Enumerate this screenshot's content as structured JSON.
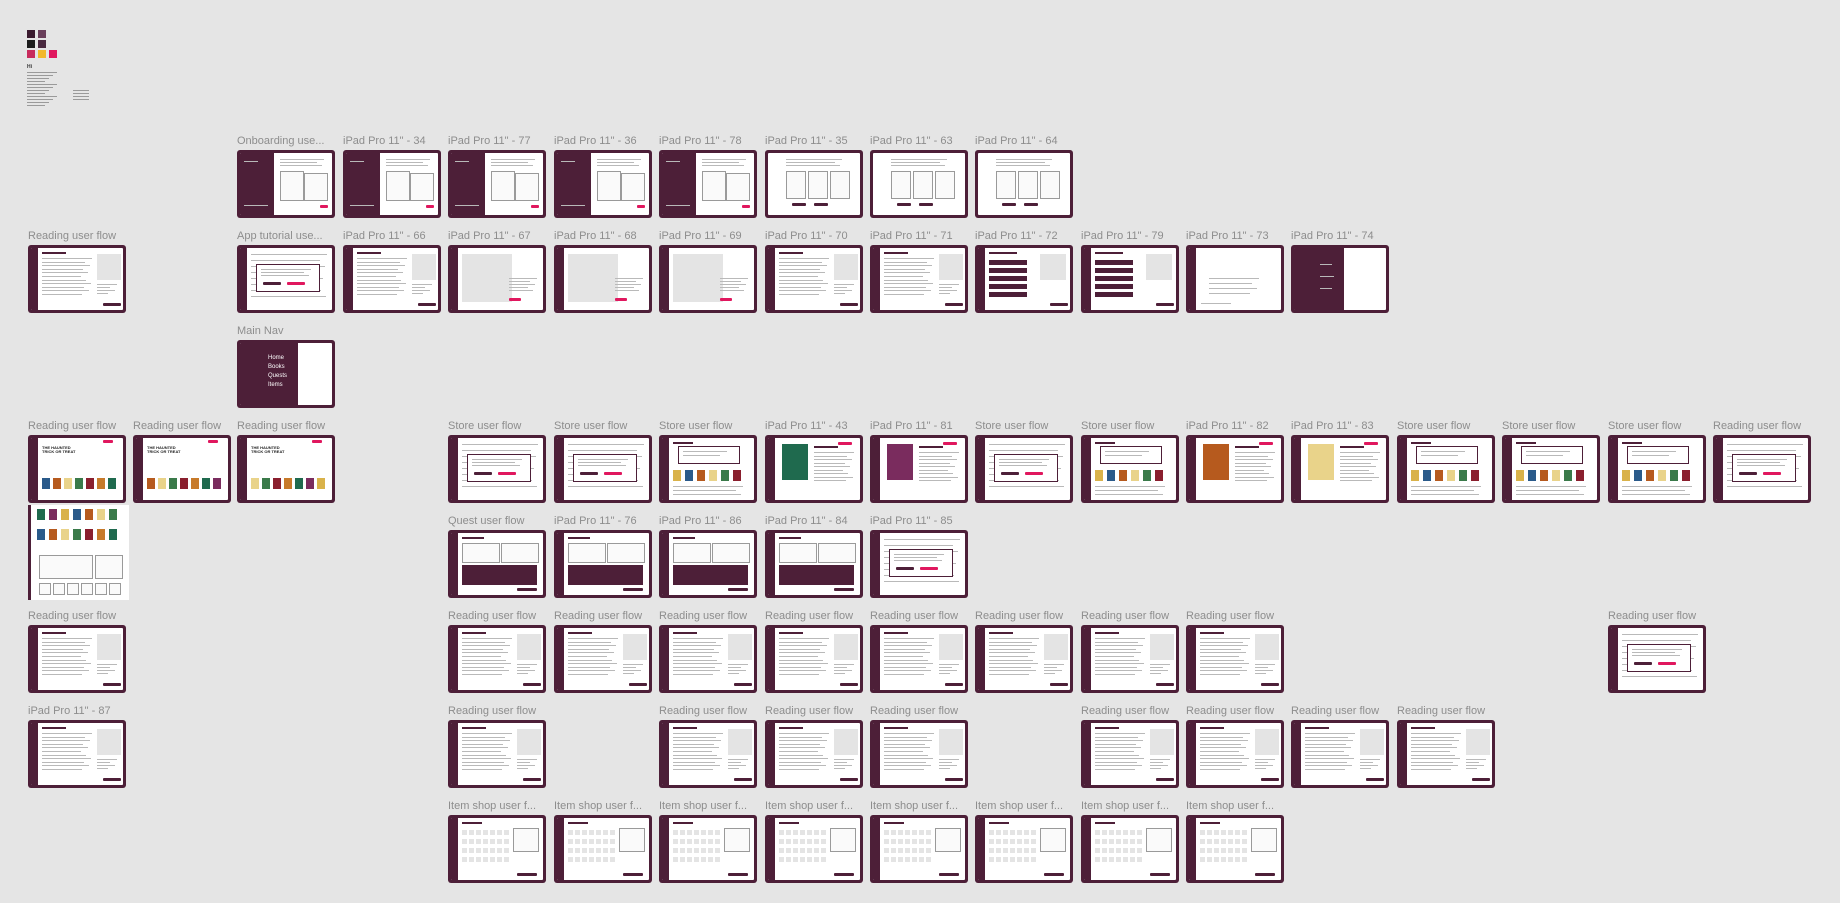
{
  "style_legend": {
    "swatches": [
      "#3a1a2e",
      "#6a3f5b",
      "#1c1c1c",
      "#4a2a40",
      "#c72b5c",
      "#f2b82c",
      "#e0175e"
    ],
    "title": "Hi"
  },
  "frames": [
    {
      "label": "Onboarding use...",
      "type": "onboard"
    },
    {
      "label": "iPad Pro 11\" - 34",
      "type": "onboard"
    },
    {
      "label": "iPad Pro 11\" - 77",
      "type": "onboard"
    },
    {
      "label": "iPad Pro 11\" - 36",
      "type": "onboard"
    },
    {
      "label": "iPad Pro 11\" - 78",
      "type": "onboard"
    },
    {
      "label": "iPad Pro 11\" - 35",
      "type": "sketch"
    },
    {
      "label": "iPad Pro 11\" - 63",
      "type": "sketch"
    },
    {
      "label": "iPad Pro 11\" - 64",
      "type": "sketch"
    },
    {
      "label": "Reading user flow",
      "type": "reading"
    },
    {
      "label": "App tutorial use...",
      "type": "dialog"
    },
    {
      "label": "iPad Pro 11\" - 66",
      "type": "reading"
    },
    {
      "label": "iPad Pro 11\" - 67",
      "type": "tutorial"
    },
    {
      "label": "iPad Pro 11\" - 68",
      "type": "tutorial"
    },
    {
      "label": "iPad Pro 11\" - 69",
      "type": "tutorial"
    },
    {
      "label": "iPad Pro 11\" - 70",
      "type": "reading"
    },
    {
      "label": "iPad Pro 11\" - 71",
      "type": "reading"
    },
    {
      "label": "iPad Pro 11\" - 72",
      "type": "quiz"
    },
    {
      "label": "iPad Pro 11\" - 79",
      "type": "quiz"
    },
    {
      "label": "iPad Pro 11\" - 73",
      "type": "blank"
    },
    {
      "label": "iPad Pro 11\" - 74",
      "type": "menu"
    },
    {
      "label": "Main Nav",
      "type": "mainnav",
      "items": [
        "Home",
        "Books",
        "Quests",
        "Items"
      ]
    },
    {
      "label": "Reading user flow",
      "type": "home",
      "heading": "THE HAUNTED TRICK OR TREAT"
    },
    {
      "label": "Reading user flow",
      "type": "home",
      "heading": "THE HAUNTED TRICK OR TREAT"
    },
    {
      "label": "Reading user flow",
      "type": "home",
      "heading": "THE HAUNTED TRICK OR TREAT"
    },
    {
      "label": "Store user flow",
      "type": "dialog"
    },
    {
      "label": "Store user flow",
      "type": "dialog"
    },
    {
      "label": "Store user flow",
      "type": "store"
    },
    {
      "label": "iPad Pro 11\" - 43",
      "type": "bookdetail"
    },
    {
      "label": "iPad Pro 11\" - 81",
      "type": "bookdetail"
    },
    {
      "label": "Store user flow",
      "type": "dialog"
    },
    {
      "label": "Store user flow",
      "type": "store"
    },
    {
      "label": "iPad Pro 11\" - 82",
      "type": "bookdetail"
    },
    {
      "label": "iPad Pro 11\" - 83",
      "type": "bookdetail"
    },
    {
      "label": "Store user flow",
      "type": "store"
    },
    {
      "label": "Store user flow",
      "type": "store"
    },
    {
      "label": "Store user flow",
      "type": "store"
    },
    {
      "label": "Reading user flow",
      "type": "dialog"
    },
    {
      "label": "Quest user flow",
      "type": "quest"
    },
    {
      "label": "iPad Pro 11\" - 76",
      "type": "quest"
    },
    {
      "label": "iPad Pro 11\" - 86",
      "type": "quest"
    },
    {
      "label": "iPad Pro 11\" - 84",
      "type": "quest"
    },
    {
      "label": "iPad Pro 11\" - 85",
      "type": "dialog"
    },
    {
      "label": "Reading user flow",
      "type": "reading"
    },
    {
      "label": "Reading user flow",
      "type": "reading"
    },
    {
      "label": "Reading user flow",
      "type": "reading"
    },
    {
      "label": "Reading user flow",
      "type": "reading"
    },
    {
      "label": "Reading user flow",
      "type": "reading"
    },
    {
      "label": "Reading user flow",
      "type": "reading"
    },
    {
      "label": "Reading user flow",
      "type": "reading"
    },
    {
      "label": "Reading user flow",
      "type": "reading"
    },
    {
      "label": "Reading user flow",
      "type": "reading"
    },
    {
      "label": "Reading user flow",
      "type": "dialog"
    },
    {
      "label": "iPad Pro 11\" - 87",
      "type": "reading"
    },
    {
      "label": "Reading user flow",
      "type": "reading"
    },
    {
      "label": "Reading user flow",
      "type": "reading"
    },
    {
      "label": "Reading user flow",
      "type": "reading"
    },
    {
      "label": "Reading user flow",
      "type": "reading"
    },
    {
      "label": "Reading user flow",
      "type": "reading"
    },
    {
      "label": "Reading user flow",
      "type": "reading"
    },
    {
      "label": "Reading user flow",
      "type": "reading"
    },
    {
      "label": "Reading user flow",
      "type": "reading"
    },
    {
      "label": "Item shop user f...",
      "type": "shop"
    },
    {
      "label": "Item shop user f...",
      "type": "shop"
    },
    {
      "label": "Item shop user f...",
      "type": "shop"
    },
    {
      "label": "Item shop user f...",
      "type": "shop"
    },
    {
      "label": "Item shop user f...",
      "type": "shop"
    },
    {
      "label": "Item shop user f...",
      "type": "shop"
    },
    {
      "label": "Item shop user f...",
      "type": "shop"
    },
    {
      "label": "Item shop user f...",
      "type": "shop"
    }
  ]
}
